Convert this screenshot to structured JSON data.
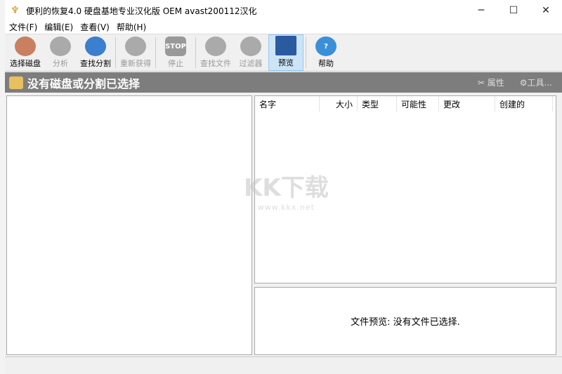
{
  "window": {
    "title": "便利的恢复4.0 硬盘基地专业汉化版 OEM avast200112汉化",
    "minimize": "─",
    "maximize": "☐",
    "close": "✕"
  },
  "menu": [
    "文件(F)",
    "编辑(E)",
    "查看(V)",
    "帮助(H)"
  ],
  "toolbar": [
    {
      "label": "选择磁盘",
      "icon": "disk-hand-icon",
      "color": "#c98060",
      "enabled": true
    },
    {
      "label": "分析",
      "icon": "analyze-icon",
      "color": "#aaaaaa",
      "enabled": false
    },
    {
      "label": "查找分割",
      "icon": "find-partition-icon",
      "color": "#3a7fd0",
      "enabled": true
    },
    {
      "label": "重新获得",
      "icon": "recover-icon",
      "color": "#aaaaaa",
      "enabled": false
    },
    {
      "label": "停止",
      "icon": "stop-icon",
      "color": "#999999",
      "enabled": false,
      "text": "STOP"
    },
    {
      "label": "查找文件",
      "icon": "find-file-icon",
      "color": "#aaaaaa",
      "enabled": false
    },
    {
      "label": "过滤器",
      "icon": "filter-icon",
      "color": "#aaaaaa",
      "enabled": false
    },
    {
      "label": "预览",
      "icon": "preview-eye-icon",
      "color": "#2a5aa0",
      "enabled": true,
      "active": true
    },
    {
      "label": "帮助",
      "icon": "help-icon",
      "color": "#3a90d8",
      "enabled": true,
      "text": "?"
    }
  ],
  "header": {
    "title": "没有磁盘或分割已选择",
    "properties": "属性",
    "tools": "工具..."
  },
  "file_list": {
    "columns": [
      "名字",
      "大小",
      "类型",
      "可能性",
      "更改",
      "创建的"
    ]
  },
  "preview": {
    "text": "文件预览: 没有文件已选择."
  },
  "watermark": {
    "logo": "KK下载",
    "url": "www.kkx.net"
  }
}
